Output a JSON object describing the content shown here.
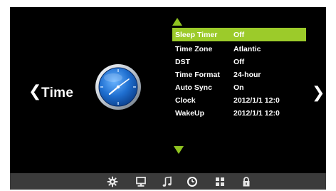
{
  "section": {
    "title": "Time"
  },
  "menu": {
    "items": [
      {
        "label": "Sleep Timer",
        "value": "Off"
      },
      {
        "label": "Time Zone",
        "value": "Atlantic"
      },
      {
        "label": "DST",
        "value": "Off"
      },
      {
        "label": "Time Format",
        "value": "24-hour"
      },
      {
        "label": "Auto Sync",
        "value": "On"
      },
      {
        "label": "Clock",
        "value": "2012/1/1 12:0"
      },
      {
        "label": "WakeUp",
        "value": "2012/1/1 12:0"
      }
    ],
    "selected_index": 0
  },
  "nav": {
    "left_glyph": "❮",
    "right_glyph": "❯"
  },
  "taskbar": {
    "icons": [
      "gear-icon",
      "monitor-icon",
      "music-icon",
      "clock-icon",
      "grid-icon",
      "lock-icon"
    ],
    "active": "clock-icon"
  },
  "colors": {
    "accent": "#9ccb2a",
    "arrow": "#8fc320",
    "background": "#000000",
    "taskbar": "#3b3b3b"
  }
}
